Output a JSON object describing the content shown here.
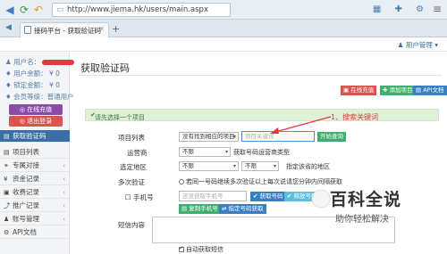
{
  "browser": {
    "url": "http://www.jiema.hk/users/main.aspx",
    "tab_title": "接码平台 - 获取验证码"
  },
  "header": {
    "user_mgmt": "用户管理"
  },
  "sidebar": {
    "username_label": "用户名：",
    "balance": "用户余额： ¥ 0",
    "frozen": "锁定金额： ¥ 0",
    "level": "会员等级：普通用户",
    "online_recharge": "在线充值",
    "logout": "退出登录",
    "menu": [
      {
        "label": "获取验证码",
        "icon": "clipboard-icon",
        "active": true
      },
      {
        "label": "项目列表",
        "icon": "list-icon",
        "active": false
      },
      {
        "label": "专属对接",
        "icon": "link-icon",
        "active": false
      },
      {
        "label": "资金记录",
        "icon": "money-icon",
        "active": false
      },
      {
        "label": "收费记录",
        "icon": "receipt-icon",
        "active": false
      },
      {
        "label": "推广记录",
        "icon": "share-icon",
        "active": false
      },
      {
        "label": "账号管理",
        "icon": "user-icon",
        "active": false
      },
      {
        "label": "API文档",
        "icon": "doc-icon",
        "active": false
      }
    ]
  },
  "main": {
    "title": "获取验证码",
    "btn_recharge": "在线充值",
    "btn_add": "添加项目",
    "btn_api": "API文档",
    "hint": "请先选择一个项目",
    "project_label": "项目列表",
    "project_select": "没有找到相应的项目",
    "search_placeholder": "项目关键词",
    "search_button": "开始查询",
    "carrier_label": "运营商",
    "carrier_select": "不限",
    "carrier_note": "获取号码运营商类型",
    "region_label": "选定地区",
    "region_select_1": "不限",
    "region_select_2": "不限",
    "region_note": "指定该省的地区",
    "multi_label": "多次验证",
    "multi_note": "若同一号码继续多次验证以上每次说请您分钟内间隔获取",
    "phone_label": "手机号",
    "phone_placeholder": "还没获取手机号",
    "get_number": "获取号码",
    "release": "释放号码",
    "copy_phone": "复制手机号",
    "specify_get": "指定号码获取",
    "sms_label": "短信内容",
    "auto_get": "自动获取短信"
  },
  "annotation": "1、搜索关键词",
  "watermark": {
    "title": "百科全说",
    "subtitle": "助你轻松解决"
  },
  "colors": {
    "sidebar_active": "#3a6ea5",
    "red": "#d9534f",
    "green": "#3faf6f",
    "blue": "#3a7fc4",
    "purple": "#8a4ba8"
  }
}
